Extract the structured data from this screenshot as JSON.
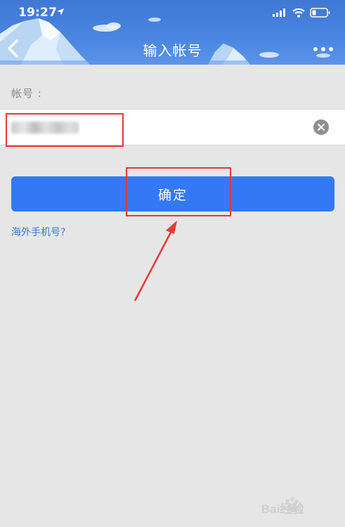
{
  "status_bar": {
    "time": "19:27"
  },
  "header": {
    "title": "输入帐号"
  },
  "form": {
    "account_label": "帐号 :",
    "account_value": "",
    "confirm_label": "确定",
    "overseas_link": "海外手机号?"
  },
  "watermark": {
    "text": "Bai经验"
  },
  "colors": {
    "primary": "#3478f6",
    "header": "#4a86e2",
    "annotation": "#e53935",
    "link": "#3a7bd5"
  }
}
